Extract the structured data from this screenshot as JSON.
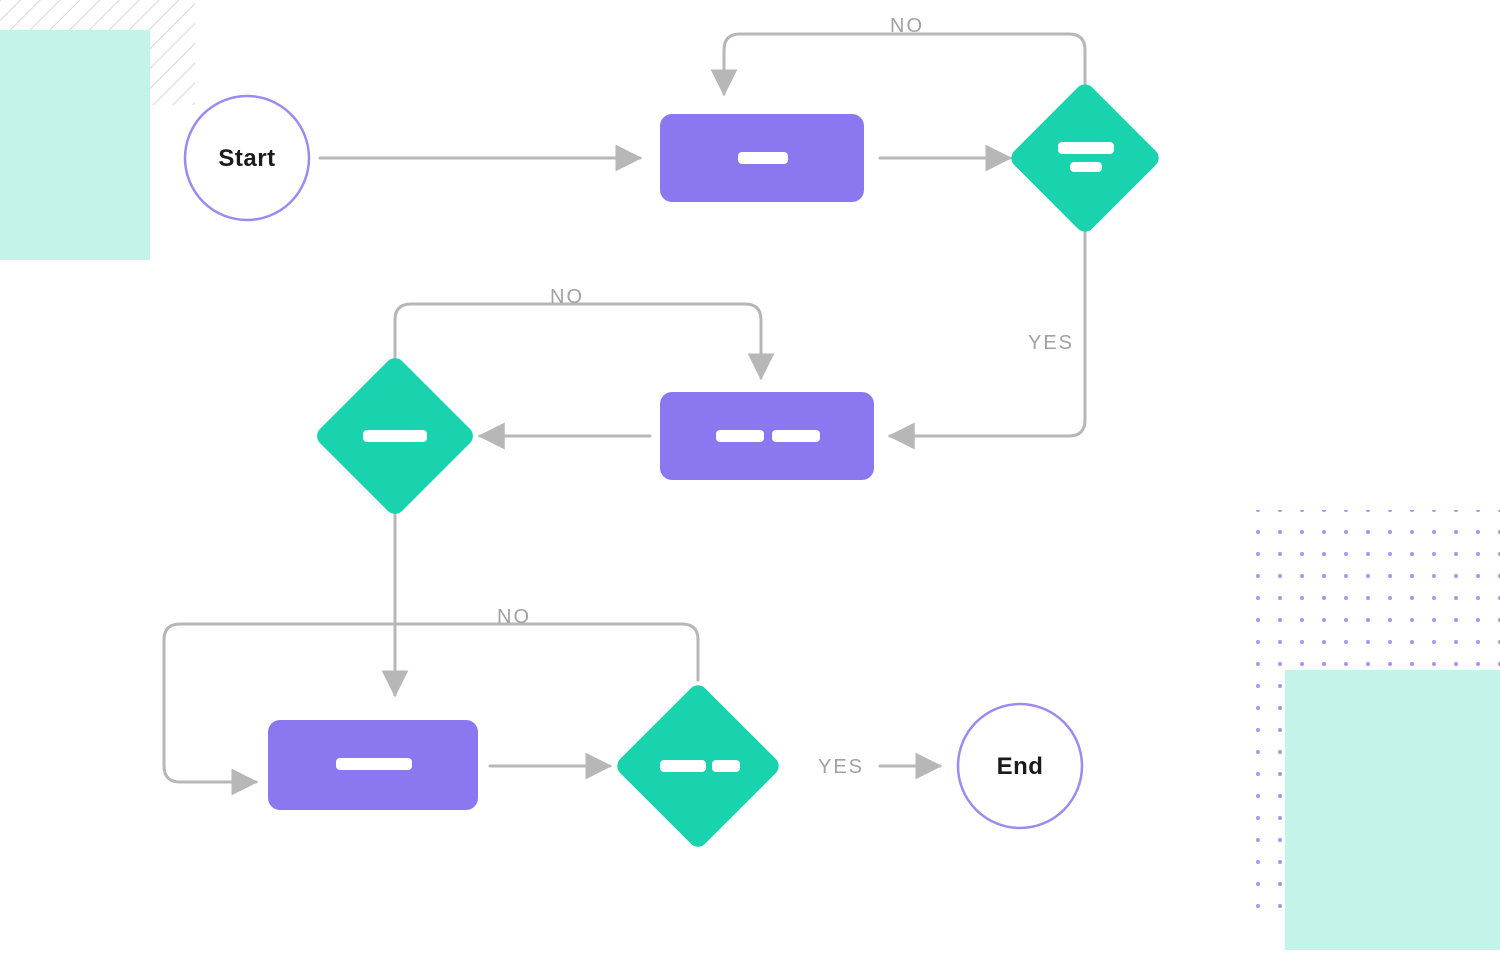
{
  "colors": {
    "purple": "#8b77f0",
    "teal": "#19d3ae",
    "tealPale": "#c4f3ea",
    "stroke": "#b7b7b7",
    "stroke2": "#b7b7b7",
    "lavender": "#9d89f2",
    "text": "#a1a1a1",
    "dark": "#1b1b1b"
  },
  "nodes": {
    "start": "Start",
    "end": "End"
  },
  "edgeLabels": {
    "no1": "NO",
    "yes1": "YES",
    "no2": "NO",
    "no3": "NO",
    "yes2": "YES"
  },
  "chart_data": {
    "type": "flowchart",
    "nodes": [
      {
        "id": "start",
        "kind": "terminator",
        "label": "Start"
      },
      {
        "id": "p1",
        "kind": "process",
        "label": ""
      },
      {
        "id": "d1",
        "kind": "decision",
        "label": ""
      },
      {
        "id": "p2",
        "kind": "process",
        "label": ""
      },
      {
        "id": "d2",
        "kind": "decision",
        "label": ""
      },
      {
        "id": "p3",
        "kind": "process",
        "label": ""
      },
      {
        "id": "d3",
        "kind": "decision",
        "label": ""
      },
      {
        "id": "end",
        "kind": "terminator",
        "label": "End"
      }
    ],
    "edges": [
      {
        "from": "start",
        "to": "p1",
        "label": ""
      },
      {
        "from": "p1",
        "to": "d1",
        "label": ""
      },
      {
        "from": "d1",
        "to": "p1",
        "label": "NO"
      },
      {
        "from": "d1",
        "to": "p2",
        "label": "YES"
      },
      {
        "from": "p2",
        "to": "d2",
        "label": ""
      },
      {
        "from": "d2",
        "to": "p2",
        "label": "NO"
      },
      {
        "from": "d2",
        "to": "p3",
        "label": ""
      },
      {
        "from": "p3",
        "to": "d3",
        "label": ""
      },
      {
        "from": "d3",
        "to": "p3",
        "label": "NO"
      },
      {
        "from": "d3",
        "to": "end",
        "label": "YES"
      }
    ]
  }
}
